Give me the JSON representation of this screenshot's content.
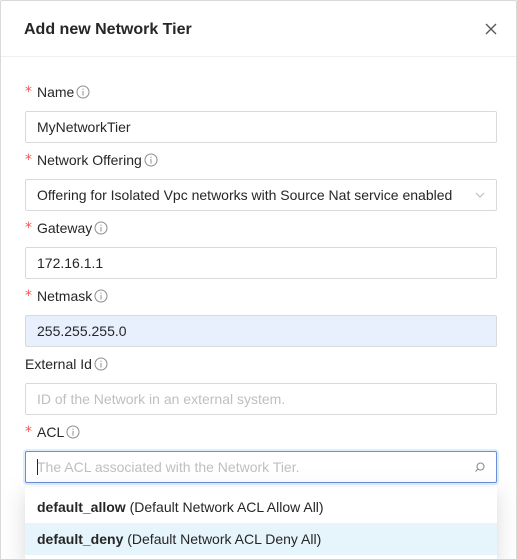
{
  "modal": {
    "title": "Add new Network Tier"
  },
  "form": {
    "required_mark": "*",
    "name": {
      "label": "Name",
      "value": "MyNetworkTier"
    },
    "network_offering": {
      "label": "Network Offering",
      "value": "Offering for Isolated Vpc networks with Source Nat service enabled"
    },
    "gateway": {
      "label": "Gateway",
      "value": "172.16.1.1"
    },
    "netmask": {
      "label": "Netmask",
      "value": "255.255.255.0"
    },
    "external_id": {
      "label": "External Id",
      "placeholder": "ID of the Network in an external system."
    },
    "acl": {
      "label": "ACL",
      "placeholder": "The ACL associated with the Network Tier.",
      "options": [
        {
          "name": "default_allow",
          "desc": "(Default Network ACL Allow All)"
        },
        {
          "name": "default_deny",
          "desc": "(Default Network ACL Deny All)"
        }
      ]
    }
  },
  "icons": {
    "close": "close-icon",
    "info": "info-circle-icon",
    "chevron": "chevron-down-icon",
    "search": "search-icon"
  },
  "colors": {
    "required": "#ff4d4f",
    "autofill_bg": "#e8f0fe",
    "focus_border": "#6c8ed8",
    "active_option_bg": "#e6f4fb",
    "placeholder": "#bfbfbf"
  }
}
